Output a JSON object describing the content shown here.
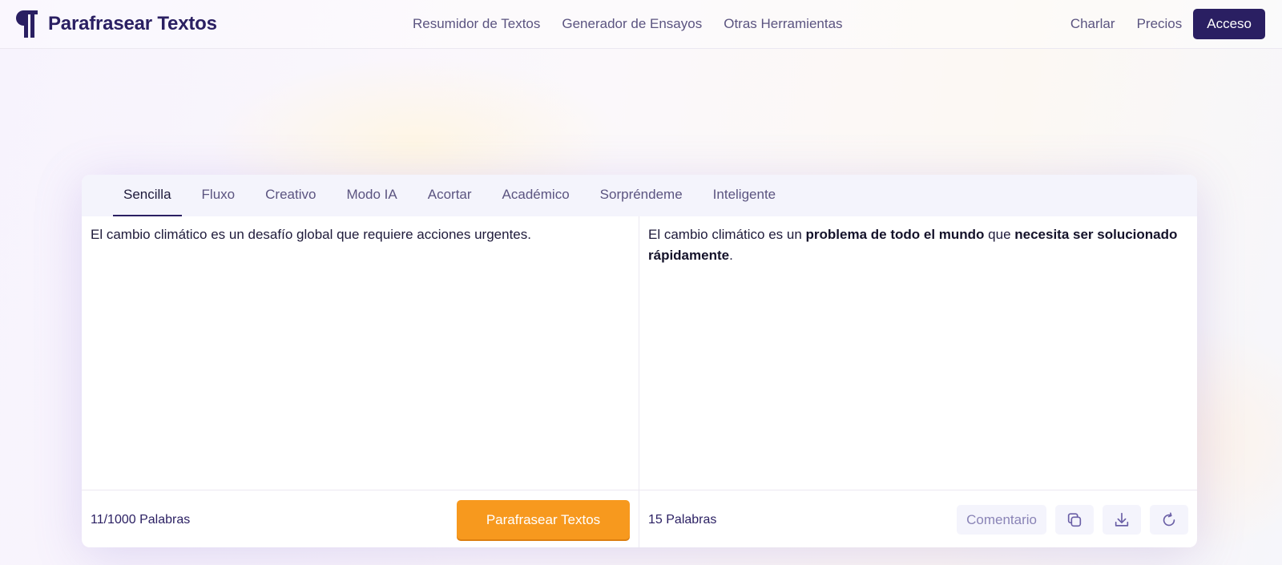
{
  "header": {
    "brand": "Parafrasear Textos",
    "nav_center": [
      "Resumidor de Textos",
      "Generador de Ensayos",
      "Otras Herramientas"
    ],
    "nav_right": [
      "Charlar",
      "Precios"
    ],
    "login_label": "Acceso"
  },
  "tabs": [
    "Sencilla",
    "Fluxo",
    "Creativo",
    "Modo IA",
    "Acortar",
    "Académico",
    "Sorpréndeme",
    "Inteligente"
  ],
  "active_tab": "Sencilla",
  "input": {
    "text": "El cambio climático es un desafío global que requiere acciones urgentes.",
    "word_count": "11/1000 Palabras",
    "submit_label": "Parafrasear Textos"
  },
  "output": {
    "segments": [
      {
        "text": "El cambio climático es un ",
        "changed": false
      },
      {
        "text": "problema de todo el mundo",
        "changed": true
      },
      {
        "text": " que ",
        "changed": false
      },
      {
        "text": "necesita ser solucionado rápidamente",
        "changed": true
      },
      {
        "text": ".",
        "changed": false
      }
    ],
    "word_count": "15 Palabras",
    "feedback_label": "Comentario",
    "icons": [
      "copy-icon",
      "download-icon",
      "refresh-icon"
    ]
  },
  "colors": {
    "brand": "#2a1f62",
    "accent": "#f7991e",
    "nav_text": "#5b5480",
    "tab_bar": "#f4f4fc"
  }
}
